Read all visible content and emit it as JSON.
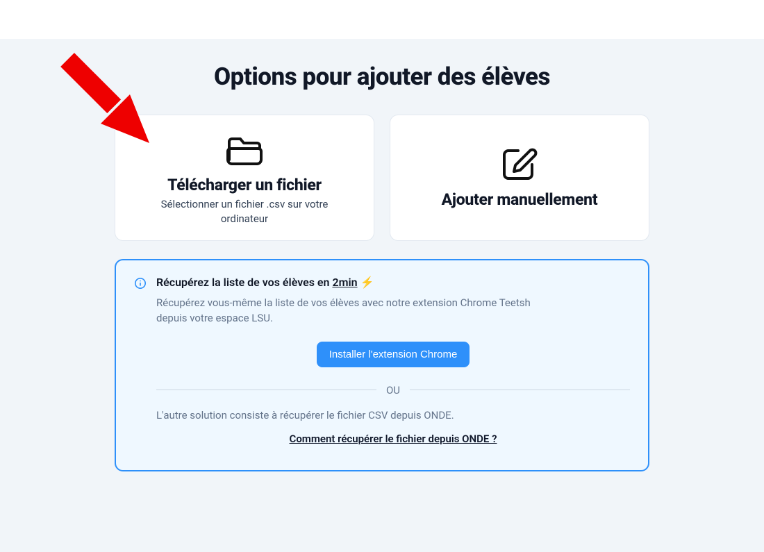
{
  "page": {
    "title": "Options pour ajouter des élèves"
  },
  "options": {
    "upload": {
      "title": "Télécharger un fichier",
      "subtitle": "Sélectionner un fichier .csv sur votre ordinateur"
    },
    "manual": {
      "title": "Ajouter manuellement"
    }
  },
  "info": {
    "title_prefix": "Récupérez la liste de vos élèves en ",
    "title_duration": "2min",
    "title_suffix": " ⚡",
    "description": "Récupérez vous-même la liste de vos élèves avec notre extension Chrome Teetsh depuis votre espace LSU.",
    "install_button": "Installer l'extension Chrome",
    "divider": "OU",
    "alt_description": "L'autre solution consiste à récupérer le fichier CSV depuis ONDE.",
    "help_link": "Comment récupérer le fichier depuis ONDE ?"
  },
  "colors": {
    "accent": "#2e90fa",
    "info_bg": "#eff8ff",
    "page_bg": "#f1f5f9"
  }
}
